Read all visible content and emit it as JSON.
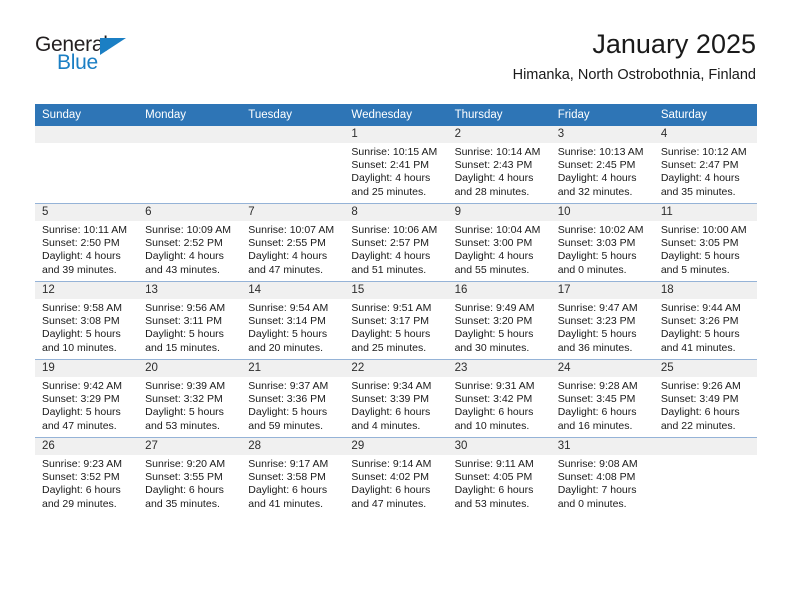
{
  "brand": {
    "name_part1": "General",
    "name_part2": "Blue",
    "accent_color": "#1b7fc4"
  },
  "header": {
    "title": "January 2025",
    "subtitle": "Himanka, North Ostrobothnia, Finland",
    "header_bg_color": "#2e75b6"
  },
  "weekday_headers": [
    "Sunday",
    "Monday",
    "Tuesday",
    "Wednesday",
    "Thursday",
    "Friday",
    "Saturday"
  ],
  "weeks": [
    [
      {
        "day": "",
        "sunrise": "",
        "sunset": "",
        "daylight1": "",
        "daylight2": ""
      },
      {
        "day": "",
        "sunrise": "",
        "sunset": "",
        "daylight1": "",
        "daylight2": ""
      },
      {
        "day": "",
        "sunrise": "",
        "sunset": "",
        "daylight1": "",
        "daylight2": ""
      },
      {
        "day": "1",
        "sunrise": "Sunrise: 10:15 AM",
        "sunset": "Sunset: 2:41 PM",
        "daylight1": "Daylight: 4 hours",
        "daylight2": "and 25 minutes."
      },
      {
        "day": "2",
        "sunrise": "Sunrise: 10:14 AM",
        "sunset": "Sunset: 2:43 PM",
        "daylight1": "Daylight: 4 hours",
        "daylight2": "and 28 minutes."
      },
      {
        "day": "3",
        "sunrise": "Sunrise: 10:13 AM",
        "sunset": "Sunset: 2:45 PM",
        "daylight1": "Daylight: 4 hours",
        "daylight2": "and 32 minutes."
      },
      {
        "day": "4",
        "sunrise": "Sunrise: 10:12 AM",
        "sunset": "Sunset: 2:47 PM",
        "daylight1": "Daylight: 4 hours",
        "daylight2": "and 35 minutes."
      }
    ],
    [
      {
        "day": "5",
        "sunrise": "Sunrise: 10:11 AM",
        "sunset": "Sunset: 2:50 PM",
        "daylight1": "Daylight: 4 hours",
        "daylight2": "and 39 minutes."
      },
      {
        "day": "6",
        "sunrise": "Sunrise: 10:09 AM",
        "sunset": "Sunset: 2:52 PM",
        "daylight1": "Daylight: 4 hours",
        "daylight2": "and 43 minutes."
      },
      {
        "day": "7",
        "sunrise": "Sunrise: 10:07 AM",
        "sunset": "Sunset: 2:55 PM",
        "daylight1": "Daylight: 4 hours",
        "daylight2": "and 47 minutes."
      },
      {
        "day": "8",
        "sunrise": "Sunrise: 10:06 AM",
        "sunset": "Sunset: 2:57 PM",
        "daylight1": "Daylight: 4 hours",
        "daylight2": "and 51 minutes."
      },
      {
        "day": "9",
        "sunrise": "Sunrise: 10:04 AM",
        "sunset": "Sunset: 3:00 PM",
        "daylight1": "Daylight: 4 hours",
        "daylight2": "and 55 minutes."
      },
      {
        "day": "10",
        "sunrise": "Sunrise: 10:02 AM",
        "sunset": "Sunset: 3:03 PM",
        "daylight1": "Daylight: 5 hours",
        "daylight2": "and 0 minutes."
      },
      {
        "day": "11",
        "sunrise": "Sunrise: 10:00 AM",
        "sunset": "Sunset: 3:05 PM",
        "daylight1": "Daylight: 5 hours",
        "daylight2": "and 5 minutes."
      }
    ],
    [
      {
        "day": "12",
        "sunrise": "Sunrise: 9:58 AM",
        "sunset": "Sunset: 3:08 PM",
        "daylight1": "Daylight: 5 hours",
        "daylight2": "and 10 minutes."
      },
      {
        "day": "13",
        "sunrise": "Sunrise: 9:56 AM",
        "sunset": "Sunset: 3:11 PM",
        "daylight1": "Daylight: 5 hours",
        "daylight2": "and 15 minutes."
      },
      {
        "day": "14",
        "sunrise": "Sunrise: 9:54 AM",
        "sunset": "Sunset: 3:14 PM",
        "daylight1": "Daylight: 5 hours",
        "daylight2": "and 20 minutes."
      },
      {
        "day": "15",
        "sunrise": "Sunrise: 9:51 AM",
        "sunset": "Sunset: 3:17 PM",
        "daylight1": "Daylight: 5 hours",
        "daylight2": "and 25 minutes."
      },
      {
        "day": "16",
        "sunrise": "Sunrise: 9:49 AM",
        "sunset": "Sunset: 3:20 PM",
        "daylight1": "Daylight: 5 hours",
        "daylight2": "and 30 minutes."
      },
      {
        "day": "17",
        "sunrise": "Sunrise: 9:47 AM",
        "sunset": "Sunset: 3:23 PM",
        "daylight1": "Daylight: 5 hours",
        "daylight2": "and 36 minutes."
      },
      {
        "day": "18",
        "sunrise": "Sunrise: 9:44 AM",
        "sunset": "Sunset: 3:26 PM",
        "daylight1": "Daylight: 5 hours",
        "daylight2": "and 41 minutes."
      }
    ],
    [
      {
        "day": "19",
        "sunrise": "Sunrise: 9:42 AM",
        "sunset": "Sunset: 3:29 PM",
        "daylight1": "Daylight: 5 hours",
        "daylight2": "and 47 minutes."
      },
      {
        "day": "20",
        "sunrise": "Sunrise: 9:39 AM",
        "sunset": "Sunset: 3:32 PM",
        "daylight1": "Daylight: 5 hours",
        "daylight2": "and 53 minutes."
      },
      {
        "day": "21",
        "sunrise": "Sunrise: 9:37 AM",
        "sunset": "Sunset: 3:36 PM",
        "daylight1": "Daylight: 5 hours",
        "daylight2": "and 59 minutes."
      },
      {
        "day": "22",
        "sunrise": "Sunrise: 9:34 AM",
        "sunset": "Sunset: 3:39 PM",
        "daylight1": "Daylight: 6 hours",
        "daylight2": "and 4 minutes."
      },
      {
        "day": "23",
        "sunrise": "Sunrise: 9:31 AM",
        "sunset": "Sunset: 3:42 PM",
        "daylight1": "Daylight: 6 hours",
        "daylight2": "and 10 minutes."
      },
      {
        "day": "24",
        "sunrise": "Sunrise: 9:28 AM",
        "sunset": "Sunset: 3:45 PM",
        "daylight1": "Daylight: 6 hours",
        "daylight2": "and 16 minutes."
      },
      {
        "day": "25",
        "sunrise": "Sunrise: 9:26 AM",
        "sunset": "Sunset: 3:49 PM",
        "daylight1": "Daylight: 6 hours",
        "daylight2": "and 22 minutes."
      }
    ],
    [
      {
        "day": "26",
        "sunrise": "Sunrise: 9:23 AM",
        "sunset": "Sunset: 3:52 PM",
        "daylight1": "Daylight: 6 hours",
        "daylight2": "and 29 minutes."
      },
      {
        "day": "27",
        "sunrise": "Sunrise: 9:20 AM",
        "sunset": "Sunset: 3:55 PM",
        "daylight1": "Daylight: 6 hours",
        "daylight2": "and 35 minutes."
      },
      {
        "day": "28",
        "sunrise": "Sunrise: 9:17 AM",
        "sunset": "Sunset: 3:58 PM",
        "daylight1": "Daylight: 6 hours",
        "daylight2": "and 41 minutes."
      },
      {
        "day": "29",
        "sunrise": "Sunrise: 9:14 AM",
        "sunset": "Sunset: 4:02 PM",
        "daylight1": "Daylight: 6 hours",
        "daylight2": "and 47 minutes."
      },
      {
        "day": "30",
        "sunrise": "Sunrise: 9:11 AM",
        "sunset": "Sunset: 4:05 PM",
        "daylight1": "Daylight: 6 hours",
        "daylight2": "and 53 minutes."
      },
      {
        "day": "31",
        "sunrise": "Sunrise: 9:08 AM",
        "sunset": "Sunset: 4:08 PM",
        "daylight1": "Daylight: 7 hours",
        "daylight2": "and 0 minutes."
      },
      {
        "day": "",
        "sunrise": "",
        "sunset": "",
        "daylight1": "",
        "daylight2": ""
      }
    ]
  ]
}
